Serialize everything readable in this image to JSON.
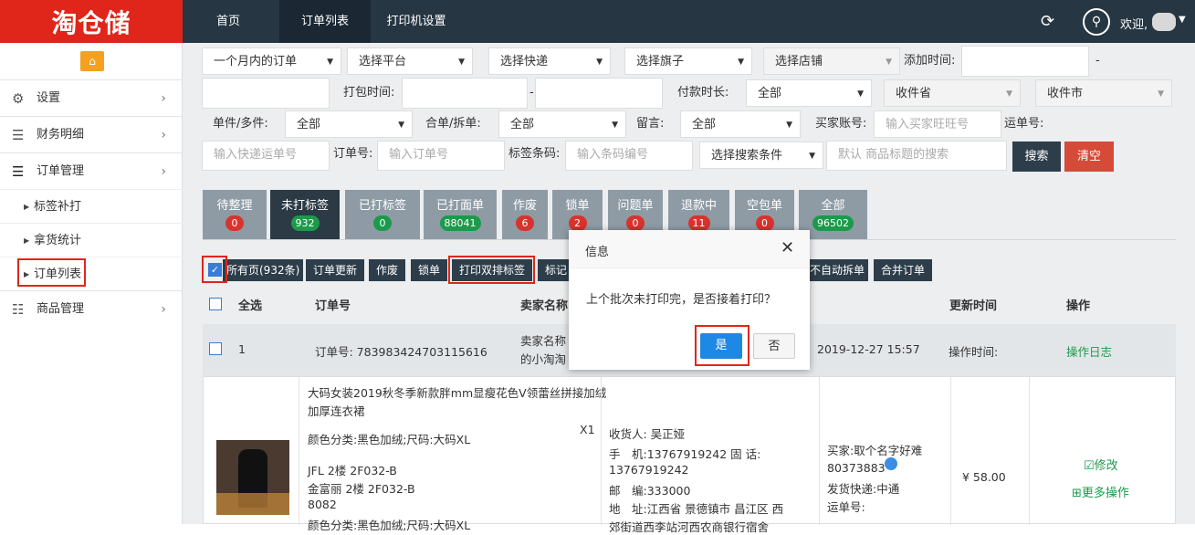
{
  "app": {
    "logo_text": "淘仓储",
    "welcome": "欢迎,"
  },
  "topnav": [
    {
      "label": "首页"
    },
    {
      "label": "订单列表"
    },
    {
      "label": "打印机设置"
    }
  ],
  "sidebar": {
    "items": [
      {
        "label": "设置"
      },
      {
        "label": "财务明细"
      },
      {
        "label": "订单管理"
      }
    ],
    "sub_items": [
      {
        "label": "标签补打"
      },
      {
        "label": "拿货统计"
      },
      {
        "label": "订单列表"
      }
    ],
    "bottom": {
      "label": "商品管理"
    }
  },
  "filters": {
    "time_range": "一个月内的订单",
    "platform": "选择平台",
    "express": "选择快递",
    "flagship": "选择旗子",
    "shop": "选择店铺",
    "add_time_label": "添加时间:",
    "dash": "-",
    "pack_time_label": "打包时间:",
    "pay_duration_label": "付款时长:",
    "pay_duration": "全部",
    "province": "收件省",
    "city": "收件市",
    "single_multi_label": "单件/多件:",
    "single_multi": "全部",
    "merge_split_label": "合单/拆单:",
    "merge_split": "全部",
    "message_label": "留言:",
    "message": "全部",
    "buyer_account_label": "买家账号:",
    "buyer_account_placeholder": "输入买家旺旺号",
    "waybill_label": "运单号:",
    "express_no_placeholder": "输入快递运单号",
    "order_no_label": "订单号:",
    "order_no_placeholder": "输入订单号",
    "barcode_label": "标签条码:",
    "barcode_placeholder": "输入条码编号",
    "search_condition": "选择搜索条件",
    "keyword_placeholder": "默认 商品标题的搜索",
    "search_btn": "搜索",
    "clear_btn": "清空"
  },
  "tabs": [
    {
      "label": "待整理",
      "count": "0",
      "color": "r"
    },
    {
      "label": "未打标签",
      "count": "932",
      "color": "g"
    },
    {
      "label": "已打标签",
      "count": "0",
      "color": "g"
    },
    {
      "label": "已打面单",
      "count": "88041",
      "color": "g"
    },
    {
      "label": "作废",
      "count": "6",
      "color": "r"
    },
    {
      "label": "锁单",
      "count": "2",
      "color": "r"
    },
    {
      "label": "问题单",
      "count": "0",
      "color": "r"
    },
    {
      "label": "退款中",
      "count": "11",
      "color": "r"
    },
    {
      "label": "空包单",
      "count": "0",
      "color": "r"
    },
    {
      "label": "全部",
      "count": "96502",
      "color": "g"
    }
  ],
  "actions": {
    "all_pages": "所有页(932条)",
    "update": "订单更新",
    "void": "作废",
    "lock": "锁单",
    "print_double": "打印双排标签",
    "mark": "标记",
    "no_auto_split": "不自动拆单",
    "merge": "合并订单"
  },
  "table": {
    "headers": {
      "select_all": "全选",
      "order_no": "订单号",
      "seller": "卖家名称",
      "update_time": "更新时间",
      "ops": "操作"
    },
    "row": {
      "index": "1",
      "order_no": "订单号: 783983424703115616",
      "seller_line1": "卖家名称",
      "seller_line2": "的小淘淘",
      "time": "2019-12-27 15:57",
      "op_time": "操作时间:",
      "log": "操作日志",
      "product_title": "大码女装2019秋冬季新款胖mm显瘦花色V领蕾丝拼接加绒加厚连衣裙",
      "product_attr": "颜色分类:黑色加绒;尺码:大码XL",
      "qty": "X1",
      "loc1": "JFL 2楼 2F032-B",
      "loc2": "金富丽 2楼 2F032-B",
      "loc3": "8082",
      "product_attr2": "颜色分类:黑色加绒;尺码:大码XL",
      "receiver": "收货人: 吴正娅",
      "phone": "手　机:13767919242  固 话:",
      "phone2": "13767919242",
      "zip": "邮　编:333000",
      "addr": "地　址:江西省 景德镇市 昌江区 西",
      "addr2": "郊街道西李站河西农商银行宿舍",
      "buyer": "买家:取个名字好难",
      "buyer_no": "80373883",
      "ship": "发货快递:中通",
      "waybill": "运单号:",
      "price": "¥ 58.00",
      "edit": "☑修改",
      "more": "⊞更多操作"
    }
  },
  "modal": {
    "title": "信息",
    "message": "上个批次未打印完，是否接着打印？",
    "yes": "是",
    "no": "否"
  }
}
